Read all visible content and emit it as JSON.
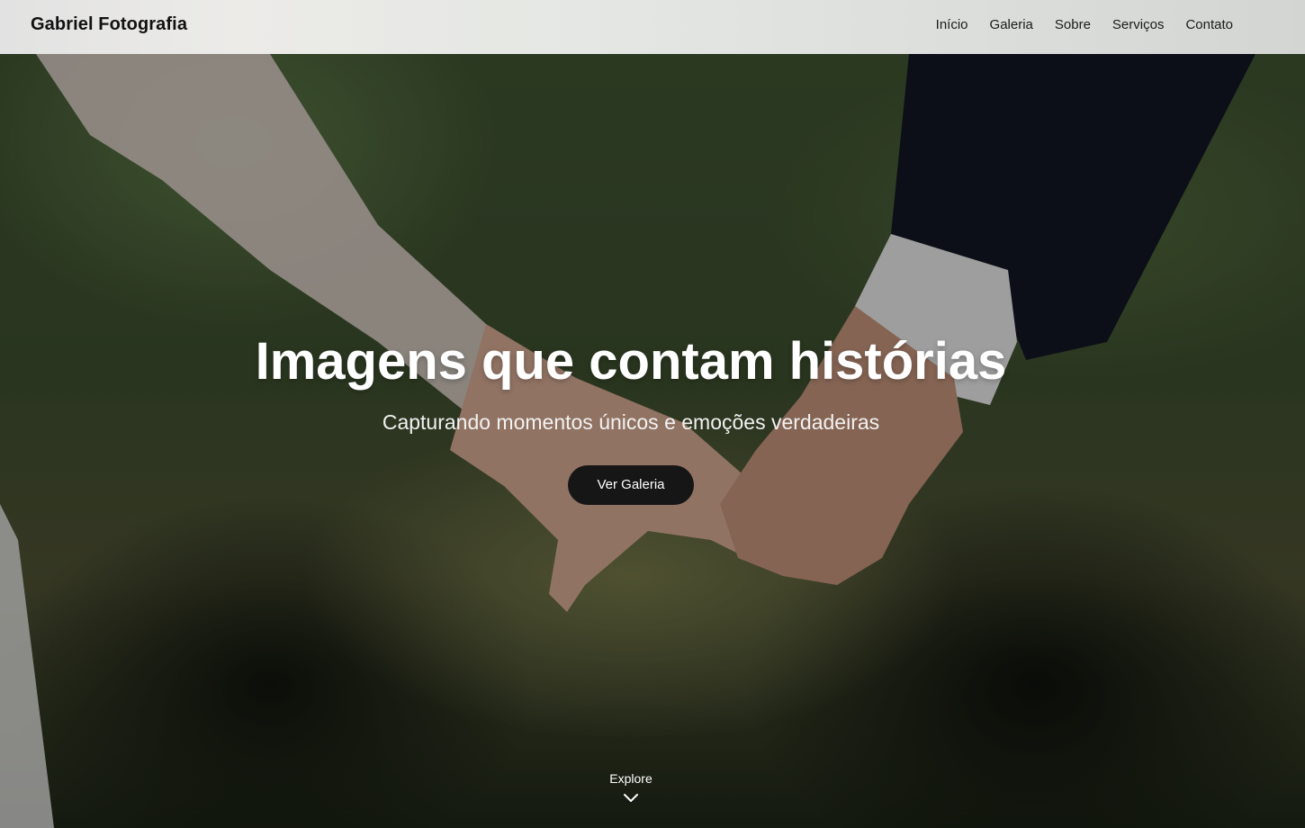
{
  "header": {
    "brand": "Gabriel Fotografia",
    "nav": [
      "Início",
      "Galeria",
      "Sobre",
      "Serviços",
      "Contato"
    ]
  },
  "hero": {
    "title": "Imagens que contam histórias",
    "subtitle": "Capturando momentos únicos e emoções verdadeiras",
    "cta_label": "Ver Galeria",
    "explore_label": "Explore",
    "explore_icon": "chevron-down-icon"
  },
  "colors": {
    "header_bg": "#e4e6e3",
    "cta_bg": "#161616",
    "text_light": "#ffffff"
  }
}
